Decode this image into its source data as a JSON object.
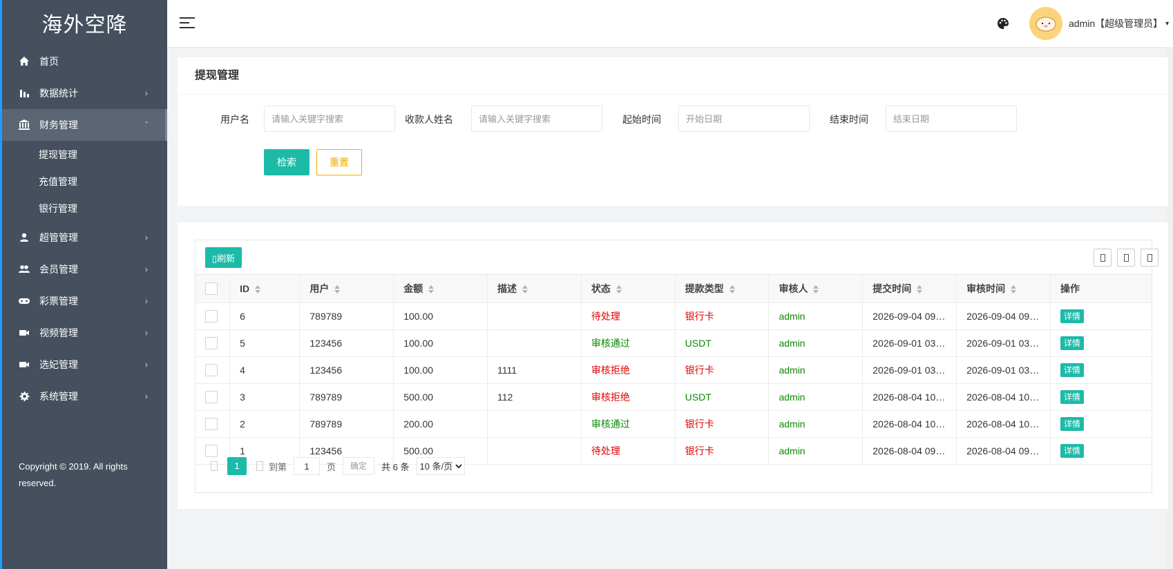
{
  "app": {
    "logo_text": "海外空降"
  },
  "sidebar": {
    "items": [
      {
        "label": "首页",
        "icon": "home-icon",
        "arrow": ""
      },
      {
        "label": "数据统计",
        "icon": "bar-chart-icon",
        "arrow": "›"
      },
      {
        "label": "财务管理",
        "icon": "bank-icon",
        "arrow": "ˇ"
      },
      {
        "label": "超管管理",
        "icon": "user-icon",
        "arrow": "›"
      },
      {
        "label": "会员管理",
        "icon": "users-icon",
        "arrow": "›"
      },
      {
        "label": "彩票管理",
        "icon": "gamepad-icon",
        "arrow": "›"
      },
      {
        "label": "视频管理",
        "icon": "video-icon",
        "arrow": "›"
      },
      {
        "label": "选妃管理",
        "icon": "video-icon",
        "arrow": "›"
      },
      {
        "label": "系统管理",
        "icon": "gear-icon",
        "arrow": "›"
      }
    ],
    "subitems": [
      {
        "label": "提现管理"
      },
      {
        "label": "充值管理"
      },
      {
        "label": "银行管理"
      }
    ],
    "copyright": "Copyright © 2019. All rights reserved."
  },
  "header": {
    "user_label": "admin【超级管理员】",
    "caret": "▾"
  },
  "search": {
    "title": "提现管理",
    "fields": [
      {
        "label": "用户名",
        "placeholder": "请输入关键字搜索"
      },
      {
        "label": "收款人姓名",
        "placeholder": "请输入关键字搜索"
      },
      {
        "label": "起始时间",
        "placeholder": "开始日期"
      },
      {
        "label": "结束时间",
        "placeholder": "结束日期"
      }
    ],
    "search_btn": "检索",
    "reset_btn": "重置"
  },
  "table": {
    "refresh_label": "刷新",
    "columns": [
      "ID",
      "用户",
      "金额",
      "描述",
      "状态",
      "提款类型",
      "审核人",
      "提交时间",
      "审核时间",
      "操作"
    ],
    "rows": [
      {
        "id": "6",
        "user": "789789",
        "amount": "100.00",
        "desc": "",
        "status": "待处理",
        "status_color": "red",
        "type": "银行卡",
        "type_color": "red",
        "auditor": "admin",
        "submit_time": "2026-09-04 09…",
        "audit_time": "2026-09-04 09…",
        "action": "详情"
      },
      {
        "id": "5",
        "user": "123456",
        "amount": "100.00",
        "desc": "",
        "status": "审核通过",
        "status_color": "green",
        "type": "USDT",
        "type_color": "green",
        "auditor": "admin",
        "submit_time": "2026-09-01 03…",
        "audit_time": "2026-09-01 03…",
        "action": "详情"
      },
      {
        "id": "4",
        "user": "123456",
        "amount": "100.00",
        "desc": "1111",
        "status": "审核拒绝",
        "status_color": "red",
        "type": "银行卡",
        "type_color": "red",
        "auditor": "admin",
        "submit_time": "2026-09-01 03…",
        "audit_time": "2026-09-01 03…",
        "action": "详情"
      },
      {
        "id": "3",
        "user": "789789",
        "amount": "500.00",
        "desc": "112",
        "status": "审核拒绝",
        "status_color": "red",
        "type": "USDT",
        "type_color": "green",
        "auditor": "admin",
        "submit_time": "2026-08-04 10…",
        "audit_time": "2026-08-04 10…",
        "action": "详情"
      },
      {
        "id": "2",
        "user": "789789",
        "amount": "200.00",
        "desc": "",
        "status": "审核通过",
        "status_color": "green",
        "type": "银行卡",
        "type_color": "red",
        "auditor": "admin",
        "submit_time": "2026-08-04 10…",
        "audit_time": "2026-08-04 10…",
        "action": "详情"
      },
      {
        "id": "1",
        "user": "123456",
        "amount": "500.00",
        "desc": "",
        "status": "待处理",
        "status_color": "red",
        "type": "银行卡",
        "type_color": "red",
        "auditor": "admin",
        "submit_time": "2026-08-04 09…",
        "audit_time": "2026-08-04 09…",
        "action": "详情"
      }
    ]
  },
  "pager": {
    "current_page": "1",
    "goto_label": "到第",
    "goto_value": "1",
    "page_suffix": "页",
    "confirm_label": "确定",
    "total_label": "共 6 条",
    "page_size_option": "10 条/页"
  },
  "colors": {
    "accent": "#1dbaa8",
    "sidebar_bg": "#454f5e",
    "status_red": "#e60000",
    "status_green": "#0b8a00",
    "reset_orange": "#f0a800"
  }
}
